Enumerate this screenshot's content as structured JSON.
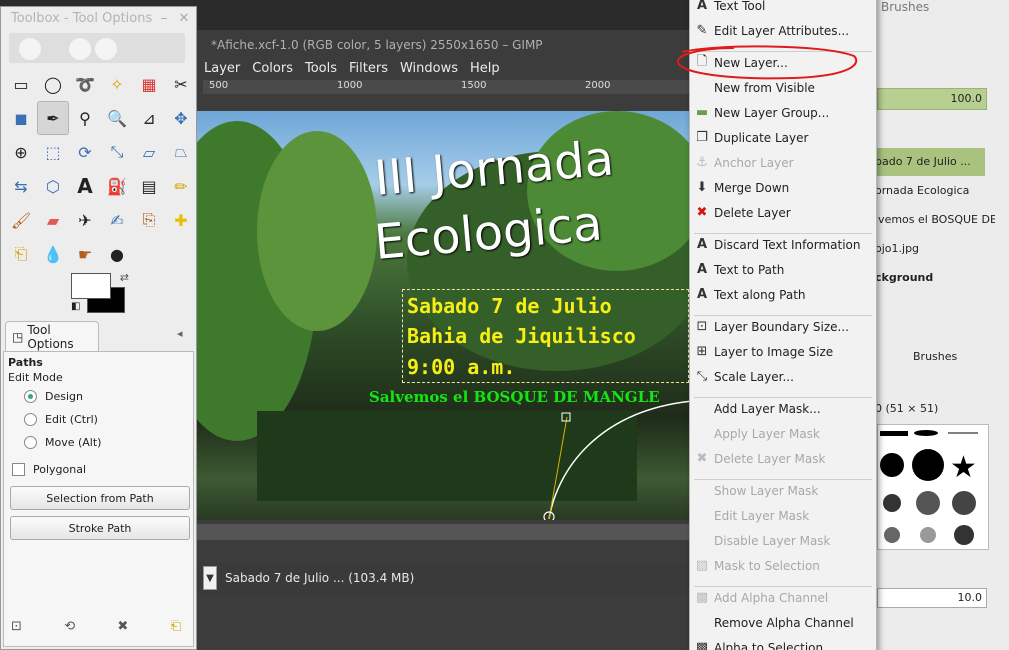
{
  "toolbox": {
    "title": "Toolbox - Tool Options",
    "tool_options_tab": "Tool Options",
    "section_title": "Paths",
    "edit_mode_label": "Edit Mode",
    "modes": [
      "Design",
      "Edit (Ctrl)",
      "Move (Alt)"
    ],
    "polygonal_label": "Polygonal",
    "selection_from_path": "Selection from Path",
    "stroke_path": "Stroke Path"
  },
  "image_window": {
    "title": "*Afiche.xcf-1.0 (RGB color, 5 layers) 2550x1650 – GIMP",
    "menus": [
      "Layer",
      "Colors",
      "Tools",
      "Filters",
      "Windows",
      "Help"
    ],
    "ruler_marks": [
      "500",
      "1000",
      "1500",
      "2000"
    ],
    "status_text": "Sabado 7 de Julio ... (103.4 MB)"
  },
  "poster": {
    "title_line1": "III Jornada",
    "title_line2": "Ecologica",
    "line1": "Sabado 7 de Julio",
    "line2": "Bahia de Jiquilisco",
    "line3": "9:00 a.m.",
    "line4": "Salvemos el BOSQUE DE MANGLE"
  },
  "dock": {
    "brushes_title": "Brushes",
    "opacity_value": "100.0",
    "layers": [
      "bado 7 de Julio ...",
      "ornada Ecologica",
      "lvemos el BOSQUE DE",
      "ojo1.jpg",
      "ckground"
    ],
    "brushes_tab": "Brushes",
    "brush_size_label": "0 (51 × 51)",
    "spacing_value": "10.0"
  },
  "context_menu": {
    "items": [
      {
        "label": "Text Tool",
        "icon": "text-icon",
        "enabled": true
      },
      {
        "label": "Edit Layer Attributes...",
        "icon": "edit-icon",
        "enabled": true
      },
      {
        "label": "New Layer...",
        "icon": "new-layer-icon",
        "enabled": true
      },
      {
        "label": "New from Visible",
        "icon": "",
        "enabled": true
      },
      {
        "label": "New Layer Group...",
        "icon": "folder-icon",
        "enabled": true
      },
      {
        "label": "Duplicate Layer",
        "icon": "duplicate-icon",
        "enabled": true
      },
      {
        "label": "Anchor Layer",
        "icon": "anchor-icon",
        "enabled": false
      },
      {
        "label": "Merge Down",
        "icon": "merge-icon",
        "enabled": true
      },
      {
        "label": "Delete Layer",
        "icon": "delete-icon",
        "enabled": true
      },
      {
        "label": "Discard Text Information",
        "icon": "text-icon",
        "enabled": true
      },
      {
        "label": "Text to Path",
        "icon": "text-icon",
        "enabled": true
      },
      {
        "label": "Text along Path",
        "icon": "text-icon",
        "enabled": true
      },
      {
        "label": "Layer Boundary Size...",
        "icon": "boundary-icon",
        "enabled": true
      },
      {
        "label": "Layer to Image Size",
        "icon": "fit-icon",
        "enabled": true
      },
      {
        "label": "Scale Layer...",
        "icon": "scale-icon",
        "enabled": true
      },
      {
        "label": "Add Layer Mask...",
        "icon": "",
        "enabled": true
      },
      {
        "label": "Apply Layer Mask",
        "icon": "",
        "enabled": false
      },
      {
        "label": "Delete Layer Mask",
        "icon": "delete-icon",
        "enabled": false
      },
      {
        "label": "Show Layer Mask",
        "icon": "",
        "enabled": false
      },
      {
        "label": "Edit Layer Mask",
        "icon": "",
        "enabled": false
      },
      {
        "label": "Disable Layer Mask",
        "icon": "",
        "enabled": false
      },
      {
        "label": "Mask to Selection",
        "icon": "mask-icon",
        "enabled": false
      },
      {
        "label": "Add Alpha Channel",
        "icon": "alpha-icon",
        "enabled": false
      },
      {
        "label": "Remove Alpha Channel",
        "icon": "",
        "enabled": true
      },
      {
        "label": "Alpha to Selection",
        "icon": "alpha-icon",
        "enabled": true
      }
    ]
  },
  "colors": {
    "accent_green": "#a9c37e",
    "annotation_red": "#e01b1b",
    "poster_yellow": "#f6ee14",
    "poster_green": "#13e713"
  }
}
